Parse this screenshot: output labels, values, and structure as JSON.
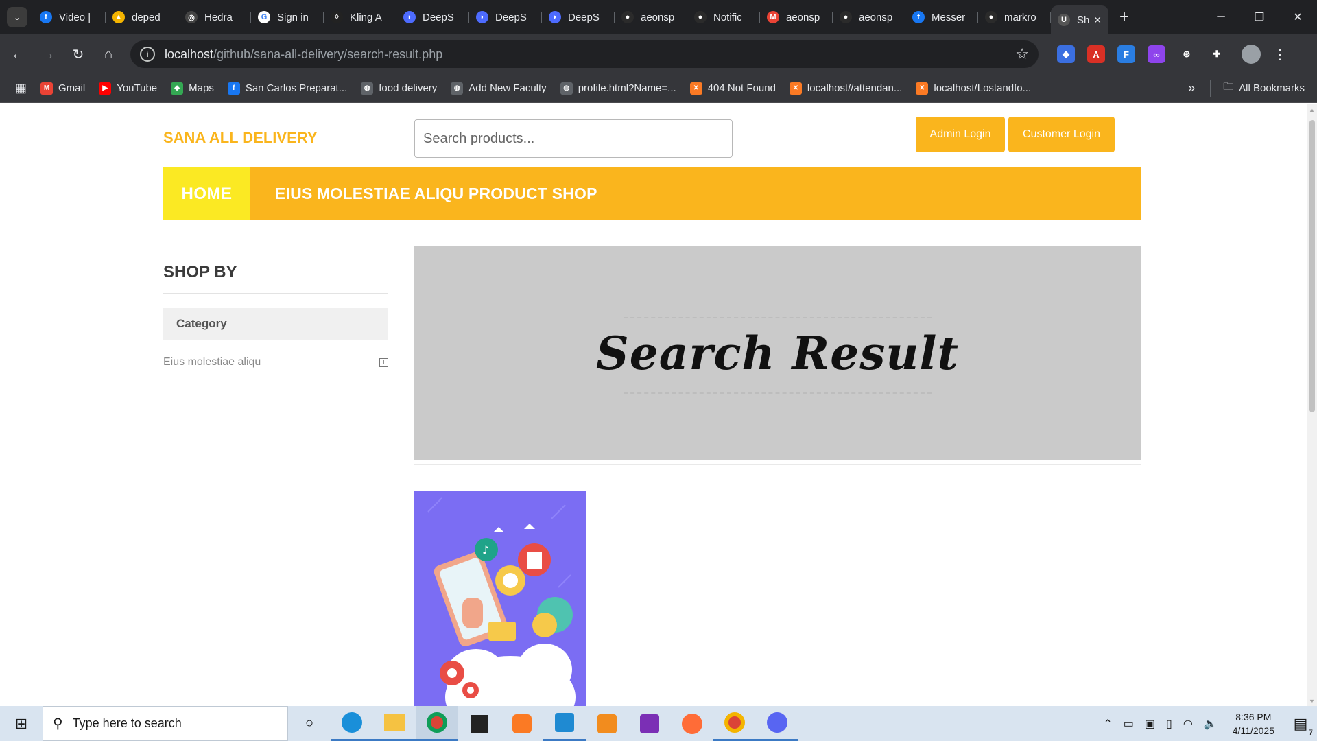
{
  "browser": {
    "tabs": [
      {
        "title": "Video |",
        "icon": "facebook-icon",
        "color": "#1877f2",
        "glyph": "f"
      },
      {
        "title": "deped",
        "icon": "google-drive-icon",
        "color": "#f4b400",
        "glyph": "▲"
      },
      {
        "title": "Hedra",
        "icon": "hedra-icon",
        "color": "#444444",
        "glyph": "◎"
      },
      {
        "title": "Sign in",
        "icon": "google-icon",
        "color": "#ffffff",
        "glyph": "G"
      },
      {
        "title": "Kling A",
        "icon": "kling-icon",
        "color": "#222222",
        "glyph": "◊"
      },
      {
        "title": "DeepS",
        "icon": "deepseek-icon",
        "color": "#4d6bfe",
        "glyph": "◗"
      },
      {
        "title": "DeepS",
        "icon": "deepseek-icon",
        "color": "#4d6bfe",
        "glyph": "◗"
      },
      {
        "title": "DeepS",
        "icon": "deepseek-icon",
        "color": "#4d6bfe",
        "glyph": "◗"
      },
      {
        "title": "aeonsp",
        "icon": "github-icon",
        "color": "#2b2b2b",
        "glyph": "●"
      },
      {
        "title": "Notific",
        "icon": "github-icon",
        "color": "#2b2b2b",
        "glyph": "●"
      },
      {
        "title": "aeonsp",
        "icon": "gmail-icon",
        "color": "#ea4335",
        "glyph": "M"
      },
      {
        "title": "aeonsp",
        "icon": "github-icon",
        "color": "#2b2b2b",
        "glyph": "●"
      },
      {
        "title": "Messer",
        "icon": "facebook-icon",
        "color": "#1877f2",
        "glyph": "f"
      },
      {
        "title": "markro",
        "icon": "github-icon",
        "color": "#2b2b2b",
        "glyph": "●"
      }
    ],
    "active_tab": {
      "title": "Sh",
      "close": "✕"
    },
    "new_tab": "+",
    "url_host": "localhost",
    "url_path": "/github/sana-all-delivery/search-result.php",
    "bookmarks": [
      {
        "label": "Gmail",
        "icon": "gmail-icon",
        "color": "#ea4335",
        "glyph": "M"
      },
      {
        "label": "YouTube",
        "icon": "youtube-icon",
        "color": "#ff0000",
        "glyph": "▶"
      },
      {
        "label": "Maps",
        "icon": "maps-icon",
        "color": "#34a853",
        "glyph": "◆"
      },
      {
        "label": "San Carlos Preparat...",
        "icon": "facebook-icon",
        "color": "#1877f2",
        "glyph": "f"
      },
      {
        "label": "food delivery",
        "icon": "globe-icon",
        "color": "#5f6368",
        "glyph": "◍"
      },
      {
        "label": "Add New Faculty",
        "icon": "globe-icon",
        "color": "#5f6368",
        "glyph": "◍"
      },
      {
        "label": "profile.html?Name=...",
        "icon": "globe-icon",
        "color": "#5f6368",
        "glyph": "◍"
      },
      {
        "label": "404 Not Found",
        "icon": "xampp-icon",
        "color": "#fb7a24",
        "glyph": "✕"
      },
      {
        "label": "localhost//attendan...",
        "icon": "xampp-icon",
        "color": "#fb7a24",
        "glyph": "✕"
      },
      {
        "label": "localhost/Lostandfo...",
        "icon": "xampp-icon",
        "color": "#fb7a24",
        "glyph": "✕"
      }
    ],
    "all_bookmarks": "All Bookmarks"
  },
  "site": {
    "brand": "SANA ALL DELIVERY",
    "search_placeholder": "Search products...",
    "admin_login": "Admin Login",
    "customer_login": "Customer Login",
    "nav_home": "HOME",
    "nav_shop": "EIUS MOLESTIAE ALIQU PRODUCT SHOP",
    "shop_by": "SHOP BY",
    "category_header": "Category",
    "category_item": "Eius molestiae aliqu",
    "banner_title": "Search Result"
  },
  "taskbar": {
    "search_placeholder": "Type here to search",
    "time": "8:36 PM",
    "date": "4/11/2025",
    "notification_count": "7"
  },
  "colors": {
    "accent": "#fab51d",
    "home_tab": "#fbe923",
    "banner_bg": "#cacaca",
    "product_bg": "#7b6df3"
  }
}
